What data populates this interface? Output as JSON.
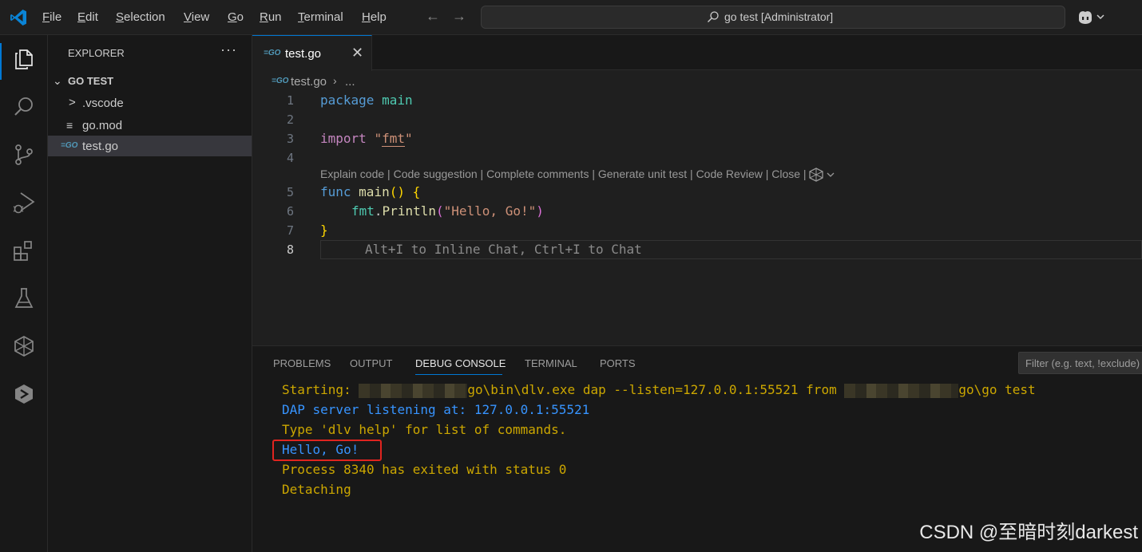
{
  "titlebar": {
    "menus": [
      {
        "mnemonic": "F",
        "rest": "ile"
      },
      {
        "mnemonic": "E",
        "rest": "dit"
      },
      {
        "mnemonic": "S",
        "rest": "election"
      },
      {
        "mnemonic": "V",
        "rest": "iew"
      },
      {
        "mnemonic": "G",
        "rest": "o"
      },
      {
        "mnemonic": "R",
        "rest": "un"
      },
      {
        "mnemonic": "T",
        "rest": "erminal"
      },
      {
        "mnemonic": "H",
        "rest": "elp"
      }
    ],
    "back_icon": "←",
    "forward_icon": "→",
    "command_center": "go test [Administrator]"
  },
  "activity_bar": {
    "items": [
      "explorer",
      "search",
      "source-control",
      "run-and-debug",
      "extensions",
      "testing",
      "codegeex",
      "remote"
    ]
  },
  "sidebar": {
    "title": "EXPLORER",
    "more": "···",
    "folder": "GO TEST",
    "items": [
      {
        "icon": ">",
        "label": ".vscode"
      },
      {
        "icon": "≡",
        "label": "go.mod"
      },
      {
        "icon": "GO",
        "label": "test.go"
      }
    ]
  },
  "editor": {
    "tab_label": "test.go",
    "tab_close": "✕",
    "breadcrumb_file": "test.go",
    "breadcrumb_sep": "›",
    "breadcrumb_more": "...",
    "line_numbers": [
      "1",
      "2",
      "3",
      "4",
      "5",
      "6",
      "7",
      "8"
    ],
    "line1": {
      "kw": "package",
      "name": "main"
    },
    "line3": {
      "kw": "import",
      "q1": "\"",
      "pkg": "fmt",
      "q2": "\""
    },
    "codelens": "Explain code | Code suggestion | Complete comments | Generate unit test | Code Review | Close |",
    "line5": {
      "kw": "func",
      "name": "main",
      "paren": "()",
      "brace": "{"
    },
    "line6": {
      "pkg": "fmt",
      "dot": ".",
      "fn": "Println",
      "open": "(",
      "str": "\"Hello, Go!\"",
      "close": ")"
    },
    "line7": {
      "brace": "}"
    },
    "inline_hint": "Alt+I to Inline Chat, Ctrl+I to Chat"
  },
  "panel": {
    "tabs": [
      "PROBLEMS",
      "OUTPUT",
      "DEBUG CONSOLE",
      "TERMINAL",
      "PORTS"
    ],
    "active_tab": "DEBUG CONSOLE",
    "filter_placeholder": "Filter (e.g. text, !exclude)",
    "console": {
      "line1_a": "Starting: ",
      "line1_b": "go\\bin\\dlv.exe dap --listen=127.0.0.1:55521 from ",
      "line1_c": "go\\go test",
      "line2": "DAP server listening at: 127.0.0.1:55521",
      "line3": "Type 'dlv help' for list of commands.",
      "line4": "Hello, Go!",
      "line5": "Process 8340 has exited with status 0",
      "line6": "Detaching"
    }
  },
  "watermark": "CSDN @至暗时刻darkest",
  "colors": {
    "accent": "#0078d4",
    "console_yellow": "#cca700",
    "console_blue": "#3794ff",
    "highlight_box": "#e0241f"
  }
}
